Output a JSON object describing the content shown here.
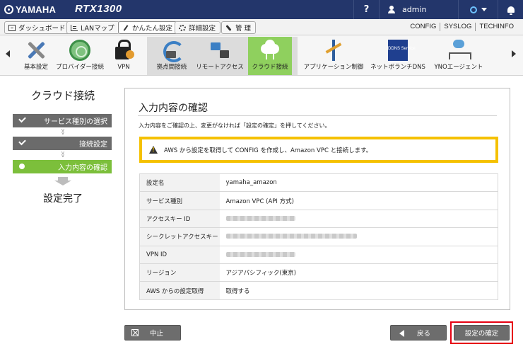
{
  "header": {
    "brand": "YAMAHA",
    "model": "RTX1300",
    "help": "?",
    "user": "admin"
  },
  "tabs": [
    {
      "label": "ダッシュボード"
    },
    {
      "label": "LANマップ"
    },
    {
      "label": "かんたん設定"
    },
    {
      "label": "詳細設定"
    },
    {
      "label": "管 理"
    }
  ],
  "links": [
    "CONFIG",
    "SYSLOG",
    "TECHINFO"
  ],
  "nav": {
    "items": [
      {
        "label": "基本設定",
        "icon": "tools-icon"
      },
      {
        "label": "プロバイダー接続",
        "icon": "globe-icon"
      },
      {
        "label": "VPN",
        "icon": "lock-icon"
      },
      {
        "label": "拠点間接続",
        "icon": "sync-icon"
      },
      {
        "label": "リモートアクセス",
        "icon": "remote-access-icon"
      },
      {
        "label": "クラウド接続",
        "icon": "cloud-icon"
      },
      {
        "label": "アプリケーション制御",
        "icon": "app-control-icon"
      },
      {
        "label": "ネットボランチDNS",
        "icon": "dns-icon",
        "icon_text": "DDNS Service"
      },
      {
        "label": "YNOエージェント",
        "icon": "yno-icon"
      }
    ]
  },
  "wizard": {
    "title": "クラウド接続",
    "steps": [
      "サービス種別の選択",
      "接続設定",
      "入力内容の確認"
    ],
    "done": "設定完了"
  },
  "panel": {
    "title": "入力内容の確認",
    "description": "入力内容をご確認の上、変更がなければ「設定の確定」を押してください。",
    "notice": "AWS から設定を取得して CONFIG を作成し、Amazon VPC と接続します。",
    "rows": [
      {
        "key": "設定名",
        "value": "yamaha_amazon"
      },
      {
        "key": "サービス種別",
        "value": "Amazon VPC (API 方式)"
      },
      {
        "key": "アクセスキー ID",
        "value": ""
      },
      {
        "key": "シークレットアクセスキー",
        "value": ""
      },
      {
        "key": "VPN ID",
        "value": ""
      },
      {
        "key": "リージョン",
        "value": "アジアパシフィック(東京)"
      },
      {
        "key": "AWS からの設定取得",
        "value": "取得する"
      }
    ]
  },
  "buttons": {
    "cancel": "中止",
    "back": "戻る",
    "confirm": "設定の確定"
  },
  "colors": {
    "topbar": "#23366b",
    "active_green": "#7cbf3b",
    "notice_border": "#f5c100",
    "highlight_red": "#e60012"
  }
}
